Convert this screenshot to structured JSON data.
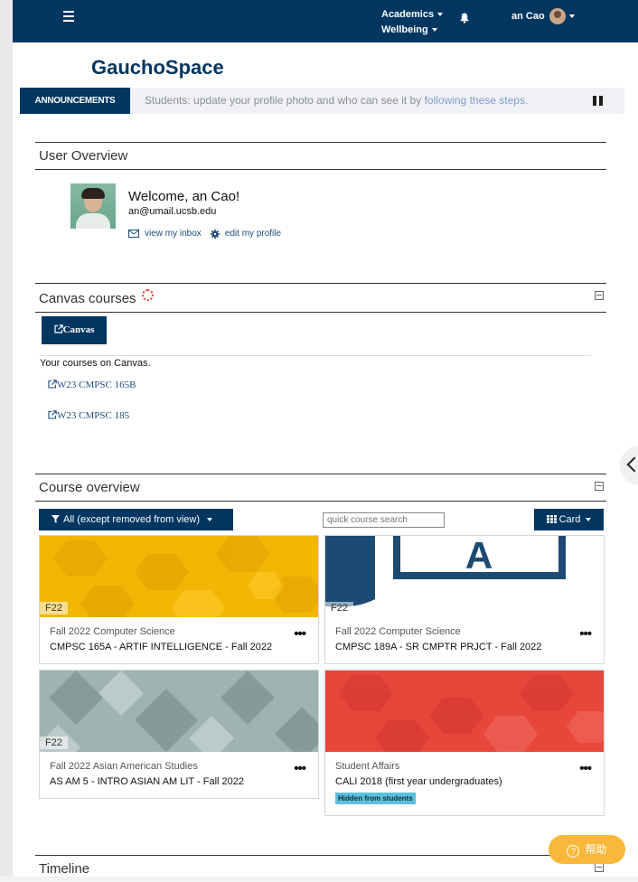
{
  "nav": {
    "menu_academics": "Academics",
    "menu_wellbeing": "Wellbeing",
    "user_name": "an Cao"
  },
  "brand": "GauchoSpace",
  "announcements": {
    "tag": "ANNOUNCEMENTS",
    "message": "Students: update your profile photo and who can see it by",
    "link": "following these steps."
  },
  "user_overview": {
    "title": "User Overview",
    "welcome": "Welcome, an Cao!",
    "email": "an@umail.ucsb.edu",
    "inbox_link": "view my inbox",
    "profile_link": "edit my profile"
  },
  "canvas": {
    "title": "Canvas courses",
    "button": "Canvas",
    "your_courses": "Your courses on Canvas.",
    "courses": [
      "W23 CMPSC 165B",
      "W23 CMPSC 185"
    ]
  },
  "course_overview": {
    "title": "Course overview",
    "filter": "All (except removed from view)",
    "search_placeholder": "quick course search",
    "view": "Card",
    "cards": [
      {
        "term": "F22",
        "category": "Fall 2022 Computer Science",
        "name": "CMPSC 165A - ARTIF INTELLIGENCE - Fall 2022",
        "color": "#f2b705"
      },
      {
        "term": "F22",
        "category": "Fall 2022 Computer Science",
        "name": "CMPSC 189A - SR CMPTR PRJCT - Fall 2022",
        "banner_text": "A",
        "color": "#1c4a72"
      },
      {
        "term": "F22",
        "category": "Fall 2022 Asian American Studies",
        "name": "AS AM 5 - INTRO ASIAN AM LIT - Fall 2022",
        "color": "#8fa6a6"
      },
      {
        "term": "",
        "category": "Student Affairs",
        "name": "CALI 2018 (first year undergraduates)",
        "badge": "Hidden from students",
        "color": "#e8463a"
      }
    ]
  },
  "timeline": {
    "title": "Timeline"
  },
  "help": {
    "label": "帮助"
  }
}
